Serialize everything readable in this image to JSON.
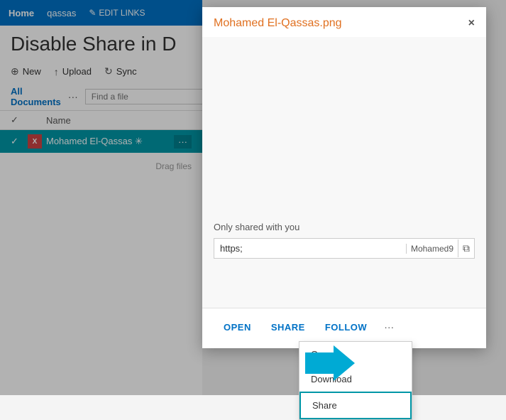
{
  "nav": {
    "home": "Home",
    "qassas": "qassas",
    "edit_links": "EDIT LINKS"
  },
  "page": {
    "title": "Disable Share in D"
  },
  "toolbar": {
    "new_label": "New",
    "upload_label": "Upload",
    "sync_label": "Sync"
  },
  "list": {
    "all_docs_label": "All Documents",
    "find_placeholder": "Find a file",
    "name_col": "Name",
    "row_name": "Mohamed El-Qassas",
    "drag_text": "Drag files"
  },
  "modal": {
    "title": "Mohamed El-Qassas.png",
    "close_label": "×",
    "shared_label": "Only shared with you",
    "url_value": "https;",
    "url_user": "Mohamed9",
    "actions": {
      "open": "OPEN",
      "share": "SHARE",
      "follow": "FOLLOW",
      "more": "···"
    },
    "context_menu": {
      "open": "Open",
      "download": "Download",
      "share": "Share"
    }
  }
}
